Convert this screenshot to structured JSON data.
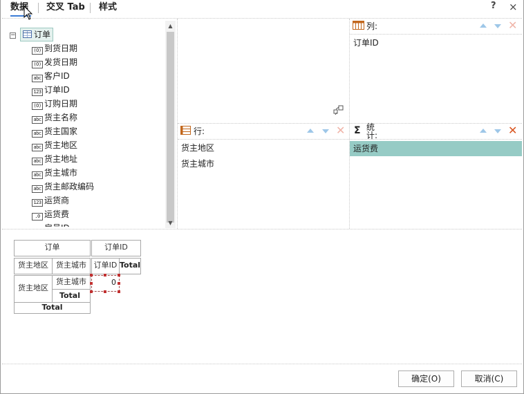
{
  "tabs": [
    {
      "label": "数据"
    },
    {
      "label": "交叉 Tab"
    },
    {
      "label": "样式"
    }
  ],
  "title_bar": {
    "help": "?",
    "close": "×"
  },
  "tree": {
    "root": "订单",
    "fields": [
      {
        "type": "date",
        "icon_text": "(O)",
        "label": "到货日期"
      },
      {
        "type": "date",
        "icon_text": "(O)",
        "label": "发货日期"
      },
      {
        "type": "string",
        "icon_text": "abc",
        "label": "客户ID"
      },
      {
        "type": "number",
        "icon_text": "123",
        "label": "订单ID"
      },
      {
        "type": "date",
        "icon_text": "(O)",
        "label": "订购日期"
      },
      {
        "type": "string",
        "icon_text": "abc",
        "label": "货主名称"
      },
      {
        "type": "string",
        "icon_text": "abc",
        "label": "货主国家"
      },
      {
        "type": "string",
        "icon_text": "abc",
        "label": "货主地区"
      },
      {
        "type": "string",
        "icon_text": "abc",
        "label": "货主地址"
      },
      {
        "type": "string",
        "icon_text": "abc",
        "label": "货主城市"
      },
      {
        "type": "string",
        "icon_text": "abc",
        "label": "货主邮政编码"
      },
      {
        "type": "number",
        "icon_text": "123",
        "label": "运货商"
      },
      {
        "type": "decimal",
        "icon_text": ".0",
        "label": "运货费"
      },
      {
        "type": "number",
        "icon_text": "123",
        "label": "雇员ID"
      }
    ]
  },
  "zones": {
    "columns": {
      "header": "列:",
      "items": [
        "订单ID"
      ]
    },
    "rows": {
      "header": "行:",
      "items": [
        "货主地区",
        "货主城市"
      ]
    },
    "summary": {
      "header_line1": "统",
      "header_line2": "计:",
      "items": [
        "运货费"
      ]
    }
  },
  "preview": {
    "table_name": "订单",
    "col_field": "订单ID",
    "row_field_1": "货主地区",
    "row_field_2": "货主城市",
    "col_value": "订单ID",
    "col_total": "Total",
    "row_value_1": "货主地区",
    "row_value_2": "货主城市",
    "subtotal": "Total",
    "grand_total": "Total",
    "cell_value": "0"
  },
  "buttons": {
    "ok": "确定(O)",
    "cancel": "取消(C)"
  },
  "colors": {
    "selected_item": "#96cbc5",
    "remove_active": "#d9541e",
    "remove_inactive": "#f0b4a8",
    "arrow": "#9ec7e8"
  }
}
